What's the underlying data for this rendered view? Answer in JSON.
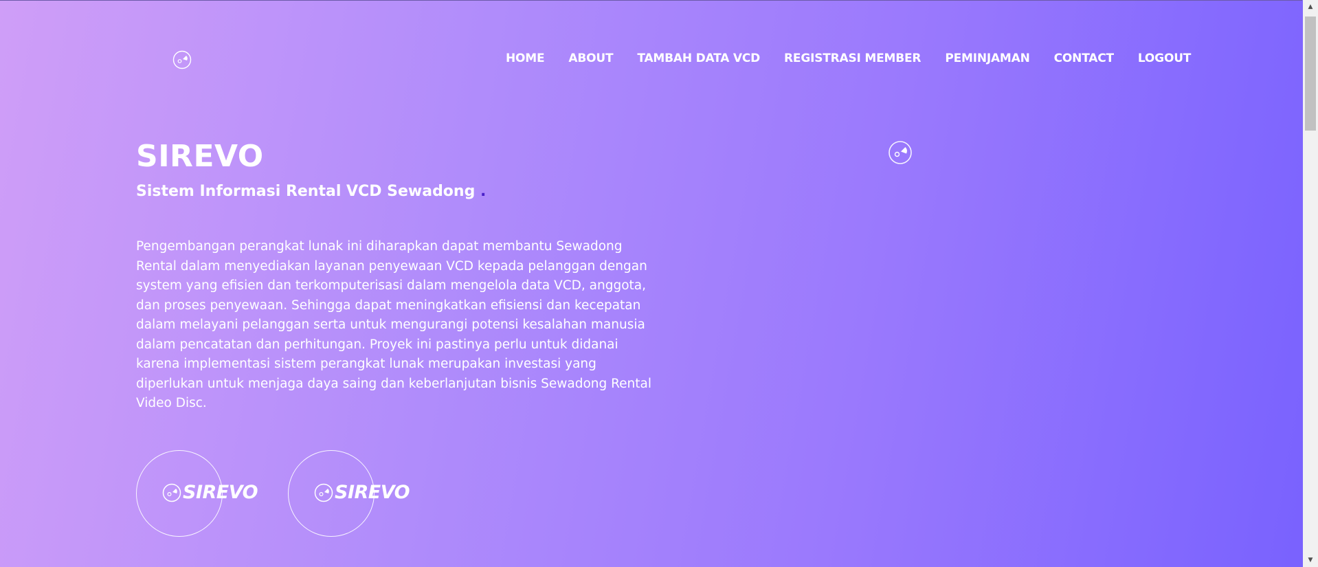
{
  "nav": {
    "items": [
      "HOME",
      "ABOUT",
      "TAMBAH DATA VCD",
      "REGISTRASI MEMBER",
      "PEMINJAMAN",
      "CONTACT",
      "LOGOUT"
    ]
  },
  "hero": {
    "title": "SIREVO",
    "subtitle": "Sistem Informasi Rental VCD Sewadong",
    "subtitle_dot": ".",
    "description": "Pengembangan perangkat lunak ini diharapkan dapat membantu Sewadong Rental dalam menyediakan layanan penyewaan VCD kepada pelanggan dengan system yang efisien dan terkomputerisasi dalam mengelola data VCD, anggota, dan proses penyewaan. Sehingga dapat meningkatkan efisiensi dan kecepatan dalam melayani pelanggan serta untuk mengurangi potensi kesalahan manusia dalam pencatatan dan perhitungan. Proyek ini pastinya perlu untuk didanai karena implementasi sistem perangkat lunak merupakan investasi yang diperlukan untuk menjaga daya saing dan keberlanjutan bisnis Sewadong Rental Video Disc."
  },
  "badges": [
    {
      "label": "SIREVO",
      "icon": "disc-icon"
    },
    {
      "label": "SIREVO",
      "icon": "disc-icon"
    }
  ],
  "icons": {
    "logo": "disc-icon",
    "scroll_up": "arrow-up-icon",
    "scroll_down": "arrow-down-icon"
  },
  "colors": {
    "gradient_start": "#cf9ef8",
    "gradient_end": "#7861fe",
    "text": "#ffffff",
    "subtitle_dot": "#4a21c9"
  }
}
